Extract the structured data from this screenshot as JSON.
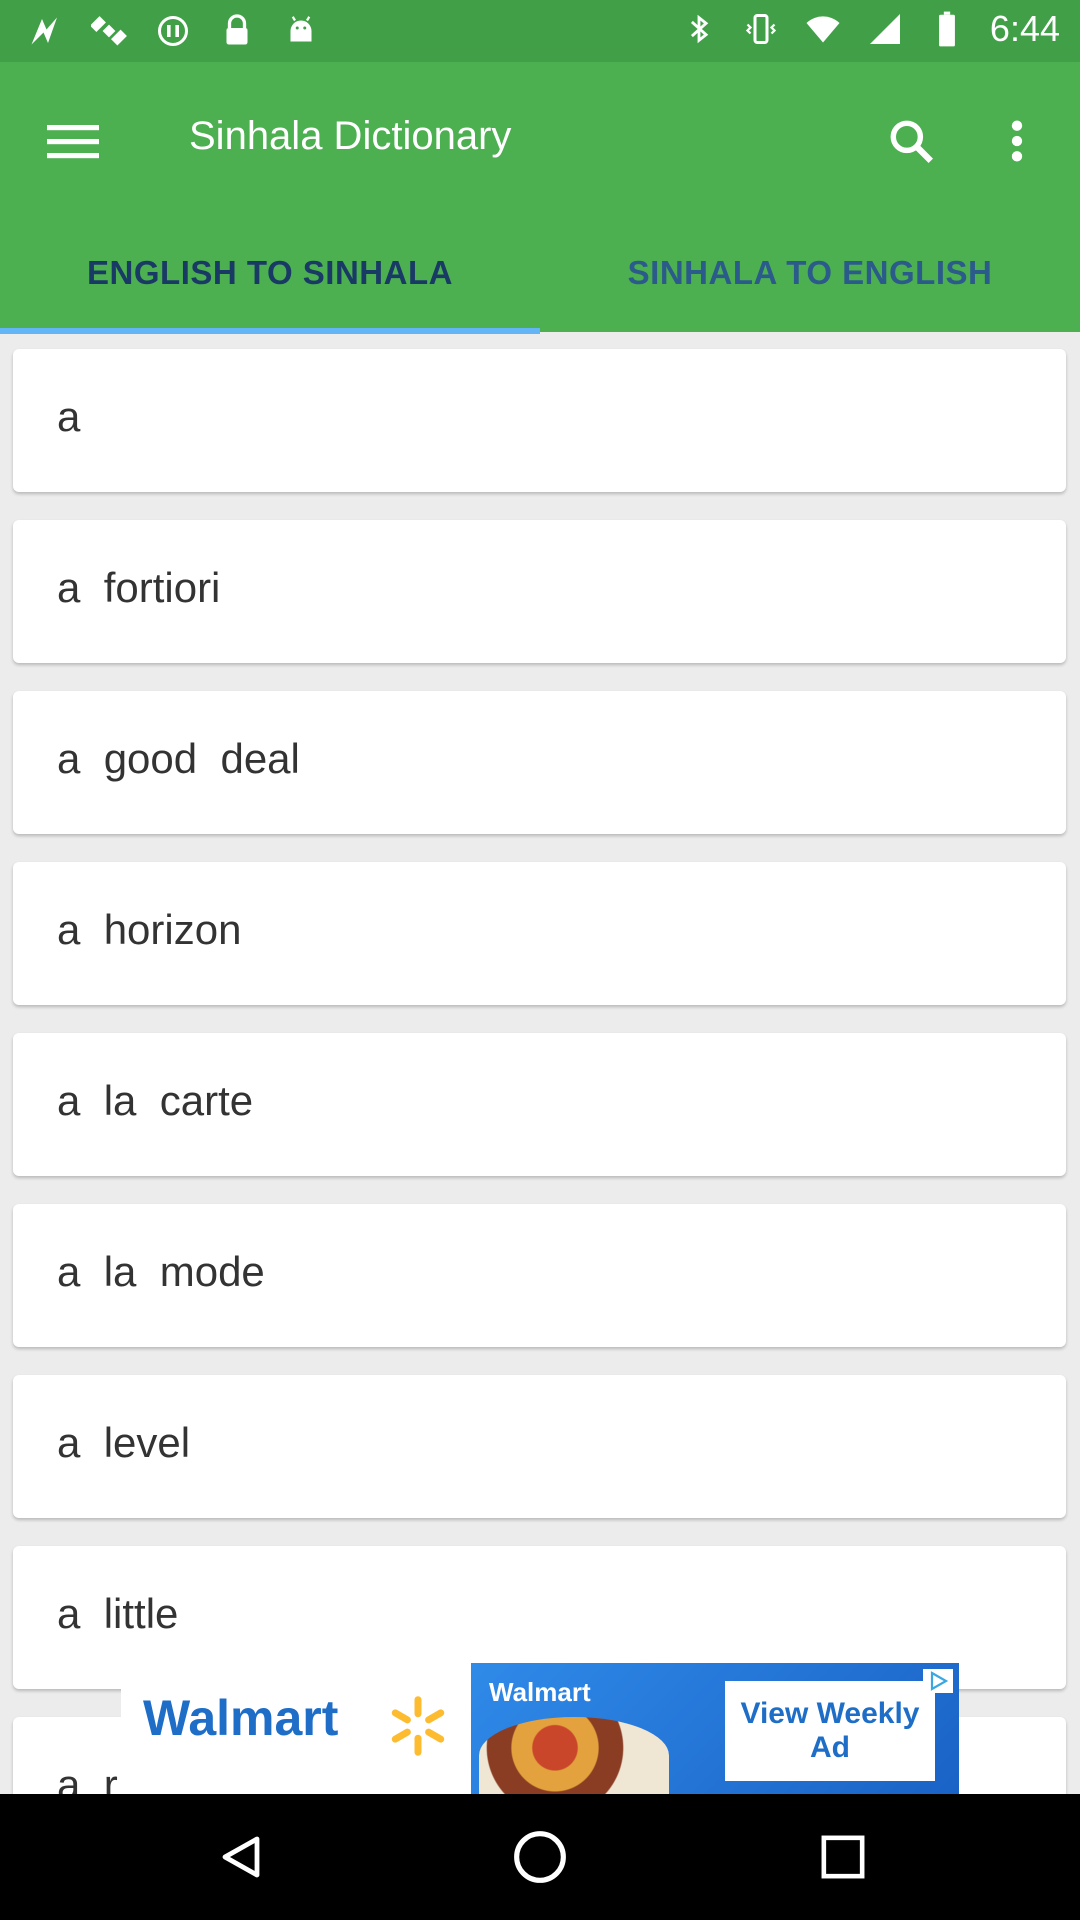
{
  "status_bar": {
    "time": "6:44",
    "left_icons": [
      "fake-gps-icon",
      "satellite-icon",
      "sync-icon",
      "lock-icon",
      "android-icon"
    ],
    "right_icons": [
      "bluetooth-icon",
      "vibrate-icon",
      "wifi-icon",
      "signal-icon",
      "battery-icon"
    ]
  },
  "app_bar": {
    "title": "Sinhala Dictionary",
    "menu_icon": "hamburger-menu-icon",
    "search_icon": "search-icon",
    "more_icon": "more-vert-icon",
    "background_color": "#4caf50"
  },
  "tabs": [
    {
      "label": "ENGLISH TO SINHALA",
      "selected": true
    },
    {
      "label": "SINHALA TO ENGLISH",
      "selected": false
    }
  ],
  "tab_indicator_color": "#64b5f6",
  "words": [
    "a",
    "a  fortiori",
    "a  good  deal",
    "a  horizon",
    "a  la  carte",
    "a  la  mode",
    "a  level",
    "a  little",
    "a  r"
  ],
  "ad": {
    "brand": "Walmart",
    "photo_brand": "Walmart",
    "cta": "View Weekly Ad",
    "icon": "ad-choices-play-icon"
  },
  "nav_bar": {
    "buttons": [
      "back-icon",
      "home-icon",
      "recents-icon"
    ]
  }
}
